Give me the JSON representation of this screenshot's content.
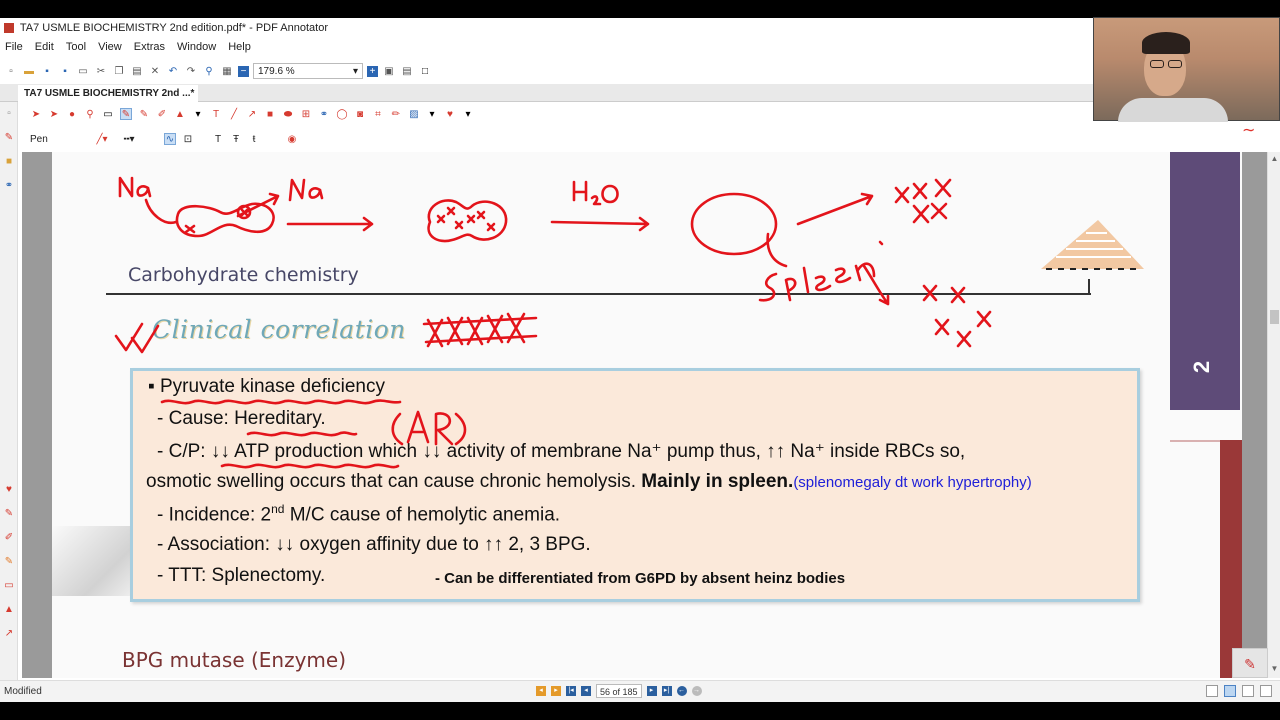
{
  "window": {
    "title": "TA7 USMLE BIOCHEMISTRY 2nd edition.pdf* - PDF Annotator"
  },
  "menu": [
    "File",
    "Edit",
    "Tool",
    "View",
    "Extras",
    "Window",
    "Help"
  ],
  "toolbar": {
    "zoom": "179.6 %"
  },
  "tab": {
    "label": "TA7 USMLE BIOCHEMISTRY 2nd ...*"
  },
  "tool": {
    "name": "Pen"
  },
  "page": {
    "section_title": "Carbohydrate chemistry",
    "chapter_number": "2",
    "clinical_heading": "Clinical correlation",
    "lines": {
      "l1": "▪ Pyruvate kinase deficiency",
      "l2": "- Cause: Hereditary.",
      "l3": "- C/P: ↓↓ ATP production which ↓↓ activity of membrane Na⁺ pump thus, ↑↑ Na⁺ inside RBCs so,",
      "l4a": "osmotic swelling occurs that can cause chronic hemolysis. ",
      "l4b": "Mainly in spleen.",
      "l4c": "(splenomegaly dt work hypertrophy)",
      "l5a": "- Incidence: 2",
      "l5sup": "nd",
      "l5b": " M/C cause of hemolytic anemia.",
      "l6": "- Association: ↓↓ oxygen affinity due to ↑↑ 2, 3 BPG.",
      "l7": "- TTT: Splenectomy.",
      "l7note": "- Can be differentiated from G6PD by absent heinz bodies"
    },
    "next_heading": "BPG mutase (Enzyme)"
  },
  "status": {
    "left": "Modified",
    "page_indicator": "56 of 185"
  },
  "colors": {
    "ink": "#e3141b",
    "chapter_block": "#5e4b78",
    "box_fill": "#fbe9da",
    "box_border": "#a8cedf",
    "note_blue": "#2020d8"
  }
}
